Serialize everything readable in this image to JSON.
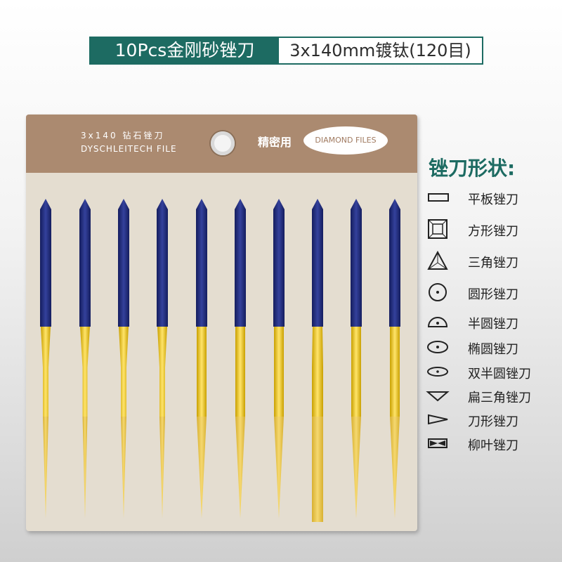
{
  "title": {
    "left": "10Pcs金刚砂锉刀",
    "right": "3x140mm镀钛(120目)"
  },
  "package": {
    "line1": "3x140 钻石锉刀",
    "line2": "DYSCHLEITECH FILE",
    "precise_label": "精密用",
    "diamond_label": "DIAMOND FILES"
  },
  "legend": {
    "title": "锉刀形状:",
    "items": [
      {
        "label": "平板锉刀",
        "icon": "flat-file-icon"
      },
      {
        "label": "方形锉刀",
        "icon": "square-file-icon"
      },
      {
        "label": "三角锉刀",
        "icon": "triangle-file-icon"
      },
      {
        "label": "圆形锉刀",
        "icon": "round-file-icon"
      },
      {
        "label": "半圆锉刀",
        "icon": "half-round-file-icon"
      },
      {
        "label": "椭圆锉刀",
        "icon": "oval-file-icon"
      },
      {
        "label": "双半圆锉刀",
        "icon": "double-half-round-file-icon"
      },
      {
        "label": "扁三角锉刀",
        "icon": "flat-triangle-file-icon"
      },
      {
        "label": "刀形锉刀",
        "icon": "knife-file-icon"
      },
      {
        "label": "柳叶锉刀",
        "icon": "willow-leaf-file-icon"
      }
    ]
  },
  "colors": {
    "brand": "#1d6b62",
    "handle": "#1f2a7a",
    "gold": "#e8c020"
  }
}
